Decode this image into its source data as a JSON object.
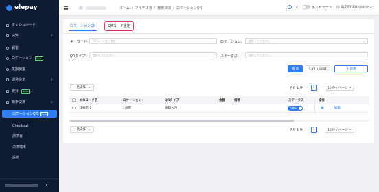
{
  "sidebar": {
    "logo_text": "elepay",
    "items": [
      {
        "label": "ダッシュボード",
        "icon": "home-icon"
      },
      {
        "label": "決済",
        "icon": "card-icon",
        "chevron": "∨"
      },
      {
        "label": "顧客",
        "icon": "user-icon"
      },
      {
        "label": "ロケーション",
        "icon": "pin-icon",
        "badge": "New"
      },
      {
        "label": "定期課金",
        "icon": "repeat-icon"
      },
      {
        "label": "開発設定",
        "icon": "code-icon",
        "chevron": "∨"
      },
      {
        "label": "統計",
        "icon": "stats-icon",
        "badge": "Beta"
      },
      {
        "label": "簡単決済",
        "icon": "cart-icon",
        "chevron": "∧"
      }
    ],
    "sub_items": [
      {
        "label": "ロケーションQR",
        "badge": "New"
      },
      {
        "label": "Checkout"
      },
      {
        "label": "請求書"
      },
      {
        "label": "決済端末"
      },
      {
        "label": "設定"
      }
    ],
    "footer_count": "0"
  },
  "topbar": {
    "breadcrumbs": [
      "ホーム",
      "マルチ決済",
      "簡単決済",
      "ロケーションQR"
    ],
    "breadcrumb_sep": "/",
    "test_mode_label": "テストモード",
    "user_name": "ELESTYLE株式会社(テス"
  },
  "tabs": [
    "ロケーションQR",
    "QRコード設定"
  ],
  "filters": {
    "keyword_label": "キーワード:",
    "keyword_placeholder": "QRコード名、備考",
    "location_label": "ロケーション:",
    "location_placeholder": "選択してください",
    "qrtype_label": "QRタイプ:",
    "qrtype_placeholder": "選択してください",
    "status_label": "ステータス:",
    "status_placeholder": "選択してください"
  },
  "actions": {
    "search": "検 索",
    "csv_export": "CSV Export",
    "new": "+ 新規"
  },
  "bulk_label": "一括操作",
  "pagination": {
    "total": "合計 1 件",
    "current_page": "1",
    "per_page": "10 件 / ページ"
  },
  "table": {
    "columns": [
      "QRコード名",
      "ロケーション",
      "QRタイプ",
      "金額",
      "備考",
      "ステータス",
      "操作"
    ],
    "rows": [
      {
        "name": "1号店-1",
        "location": "1号店",
        "qr_type": "金額入力",
        "amount": "-",
        "note": "-",
        "status": "公開中",
        "action_icon": "qr-icon",
        "action_edit": "編集"
      }
    ]
  },
  "colors": {
    "accent": "#2d7ef0",
    "sidebar_bg": "#0f1b33",
    "highlight": "#e6337a"
  }
}
